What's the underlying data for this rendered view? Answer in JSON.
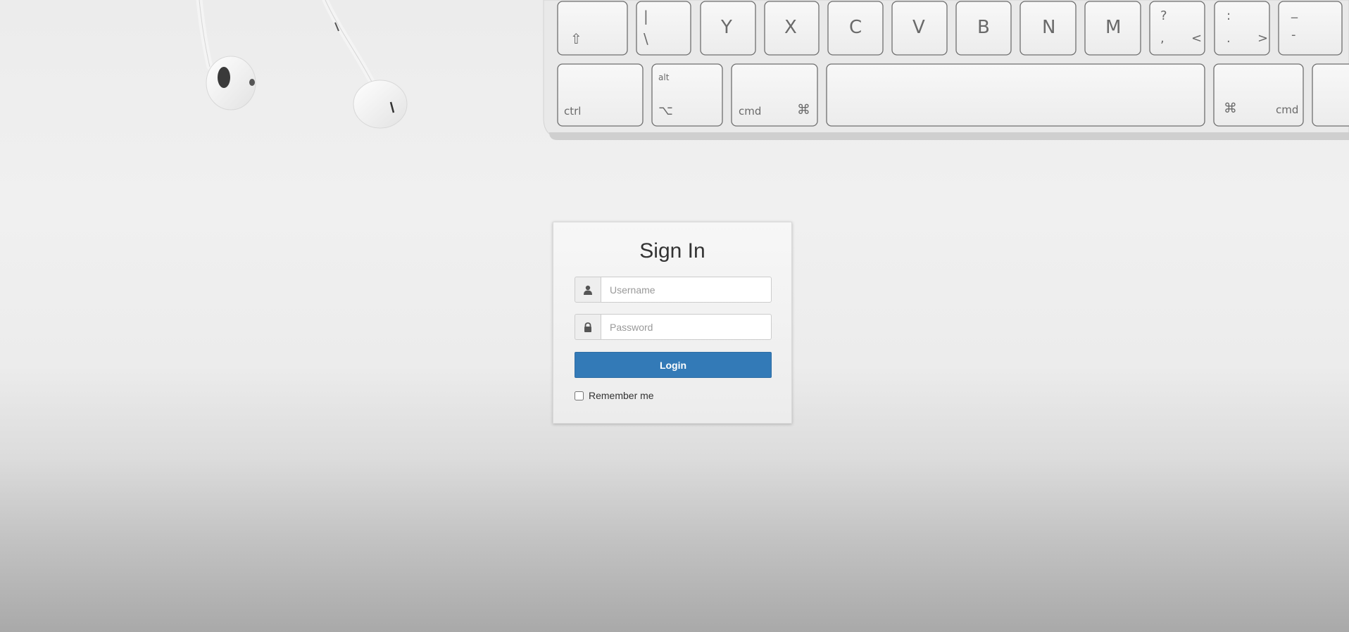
{
  "background": {
    "description_icons": [
      "earphones",
      "keyboard"
    ],
    "keyboard": {
      "row1_keys": [
        {
          "main": "⇧",
          "sub": ""
        },
        {
          "main": "|",
          "sub": "\\"
        },
        {
          "main": "Y",
          "sub": ""
        },
        {
          "main": "X",
          "sub": ""
        },
        {
          "main": "C",
          "sub": ""
        },
        {
          "main": "V",
          "sub": ""
        },
        {
          "main": "B",
          "sub": ""
        },
        {
          "main": "N",
          "sub": ""
        },
        {
          "main": "M",
          "sub": ""
        },
        {
          "main": "?",
          "sub": ","
        },
        {
          "main": ":",
          "sub": "."
        },
        {
          "main": "_",
          "sub": "-"
        }
      ],
      "row2": {
        "ctrl": "ctrl",
        "alt": "alt",
        "option_symbol": "⌥",
        "cmd_left": "cmd",
        "cmd_symbol": "⌘",
        "cmd_right": "cmd",
        "lt": "<",
        "gt": ">"
      }
    }
  },
  "login": {
    "title": "Sign In",
    "username_placeholder": "Username",
    "password_placeholder": "Password",
    "login_label": "Login",
    "remember_label": "Remember me"
  },
  "colors": {
    "primary": "#337ab7"
  }
}
